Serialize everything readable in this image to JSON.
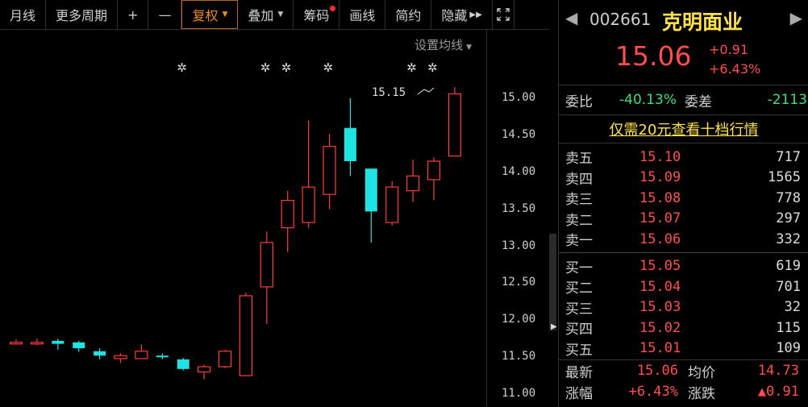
{
  "toolbar": {
    "items": [
      {
        "label": "月线",
        "dropdown": false
      },
      {
        "label": "更多周期",
        "dropdown": false
      },
      {
        "label": "+",
        "dropdown": false
      },
      {
        "label": "—",
        "dropdown": false
      },
      {
        "label": "复权",
        "dropdown": true,
        "active": true
      },
      {
        "label": "叠加",
        "dropdown": true
      },
      {
        "label": "筹码",
        "dropdown": false,
        "dot": true
      },
      {
        "label": "画线",
        "dropdown": false
      },
      {
        "label": "简约",
        "dropdown": false
      },
      {
        "label": "隐藏",
        "dropdown": false,
        "arrows": "▶▶"
      }
    ],
    "fullscreen_icon": "expand-icon"
  },
  "chart": {
    "settings_label": "设置均线",
    "max_label": "15.15",
    "price_axis": [
      "15.00",
      "14.50",
      "14.00",
      "13.50",
      "13.00",
      "12.50",
      "12.00",
      "11.50",
      "11.00"
    ],
    "up_color": "#ff3b3b",
    "down_color": "#1fe3e3",
    "star_glyph": "✲"
  },
  "chart_data": {
    "type": "candlestick",
    "y_range": [
      11.0,
      15.25
    ],
    "candles": [
      {
        "o": 11.7,
        "h": 11.74,
        "l": 11.67,
        "c": 11.7
      },
      {
        "o": 11.7,
        "h": 11.75,
        "l": 11.66,
        "c": 11.7
      },
      {
        "o": 11.72,
        "h": 11.75,
        "l": 11.6,
        "c": 11.68
      },
      {
        "o": 11.7,
        "h": 11.72,
        "l": 11.57,
        "c": 11.62
      },
      {
        "o": 11.58,
        "h": 11.62,
        "l": 11.47,
        "c": 11.52
      },
      {
        "o": 11.48,
        "h": 11.55,
        "l": 11.42,
        "c": 11.52
      },
      {
        "o": 11.48,
        "h": 11.67,
        "l": 11.48,
        "c": 11.58
      },
      {
        "o": 11.52,
        "h": 11.55,
        "l": 11.47,
        "c": 11.5
      },
      {
        "o": 11.47,
        "h": 11.49,
        "l": 11.32,
        "c": 11.34
      },
      {
        "o": 11.3,
        "h": 11.4,
        "l": 11.2,
        "c": 11.37
      },
      {
        "o": 11.37,
        "h": 11.6,
        "l": 11.35,
        "c": 11.58
      },
      {
        "o": 11.25,
        "h": 12.37,
        "l": 11.25,
        "c": 12.33
      },
      {
        "o": 12.45,
        "h": 13.2,
        "l": 11.95,
        "c": 13.05
      },
      {
        "o": 13.25,
        "h": 13.75,
        "l": 12.92,
        "c": 13.62
      },
      {
        "o": 13.32,
        "h": 14.7,
        "l": 13.25,
        "c": 13.8
      },
      {
        "o": 13.7,
        "h": 14.52,
        "l": 13.5,
        "c": 14.35
      },
      {
        "o": 14.6,
        "h": 15.0,
        "l": 13.95,
        "c": 14.15
      },
      {
        "o": 14.05,
        "h": 14.05,
        "l": 13.05,
        "c": 13.47
      },
      {
        "o": 13.32,
        "h": 13.88,
        "l": 13.28,
        "c": 13.8
      },
      {
        "o": 13.75,
        "h": 14.17,
        "l": 13.6,
        "c": 13.95
      },
      {
        "o": 13.9,
        "h": 14.2,
        "l": 13.62,
        "c": 14.15
      },
      {
        "o": 14.22,
        "h": 15.15,
        "l": 14.22,
        "c": 15.06
      }
    ],
    "star_candles": [
      8,
      12,
      13,
      15,
      19,
      20
    ]
  },
  "quote": {
    "code": "002661",
    "name": "克明面业",
    "price": "15.06",
    "change": "+0.91",
    "change_pct": "+6.43%",
    "weibi_label": "委比",
    "weibi_value": "-40.13%",
    "weicha_label": "委差",
    "weicha_value": "-2113",
    "tenlevel_link": "仅需20元查看十档行情"
  },
  "order_book": {
    "asks": [
      {
        "label": "卖五",
        "price": "15.10",
        "volume": "717"
      },
      {
        "label": "卖四",
        "price": "15.09",
        "volume": "1565"
      },
      {
        "label": "卖三",
        "price": "15.08",
        "volume": "778"
      },
      {
        "label": "卖二",
        "price": "15.07",
        "volume": "297"
      },
      {
        "label": "卖一",
        "price": "15.06",
        "volume": "332"
      }
    ],
    "bids": [
      {
        "label": "买一",
        "price": "15.05",
        "volume": "619"
      },
      {
        "label": "买二",
        "price": "15.04",
        "volume": "701"
      },
      {
        "label": "买三",
        "price": "15.03",
        "volume": "32"
      },
      {
        "label": "买四",
        "price": "15.02",
        "volume": "115"
      },
      {
        "label": "买五",
        "price": "15.01",
        "volume": "109"
      }
    ]
  },
  "stats": {
    "latest_label": "最新",
    "latest_value": "15.06",
    "avg_label": "均价",
    "avg_value": "14.73",
    "pct_label": "涨幅",
    "pct_value": "+6.43%",
    "chg_label": "涨跌",
    "chg_value": "▲0.91"
  }
}
